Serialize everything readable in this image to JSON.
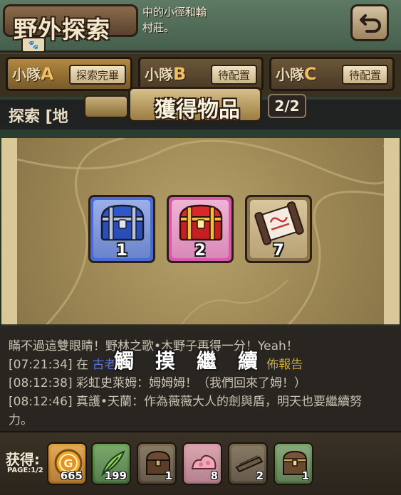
{
  "header": {
    "title": "野外探索",
    "description": "中的小徑和輪\n村莊。",
    "back_icon": "return-arrow-icon"
  },
  "squads": [
    {
      "label_prefix": "小隊",
      "letter": "A",
      "state": "探索完畢"
    },
    {
      "label_prefix": "小隊",
      "letter": "B",
      "state": "待配置"
    },
    {
      "label_prefix": "小隊",
      "letter": "C",
      "state": "待配置"
    }
  ],
  "location": {
    "text": "探索 [地"
  },
  "reward_popup": {
    "title": "獲得物品",
    "page": "2/2",
    "items": [
      {
        "icon": "blue-treasure-chest-icon",
        "count": "1",
        "frame_color": "#4a6ad8"
      },
      {
        "icon": "red-treasure-chest-icon",
        "count": "2",
        "frame_color": "#d85aa8"
      },
      {
        "icon": "scroll-icon",
        "count": "7",
        "frame_color": "#8a7448"
      }
    ]
  },
  "log": {
    "lines": [
      {
        "ts": "",
        "text": "瞞不過這雙眼睛！野林之歌•木野子再得一分！Yeah！"
      },
      {
        "ts": "[07:21:34]",
        "pre": "在",
        "hl": "古老",
        "mid": "",
        "hl2": "佈報告",
        "text": ""
      },
      {
        "ts": "[08:12:38]",
        "text": "彩虹史萊姆：姆姆姆！（我們回來了姆！）"
      },
      {
        "ts": "[08:12:46]",
        "text": "真護•天蘭：作為薇薇大人的劍與盾，明天也要繼續努"
      },
      {
        "ts": "",
        "text": "力。"
      }
    ],
    "continue_chars": [
      "觸",
      "摸",
      "繼",
      "續"
    ]
  },
  "gains": {
    "label": "获得:",
    "page": "PAGE:1/2",
    "items": [
      {
        "icon": "gold-coin-icon",
        "count": "665"
      },
      {
        "icon": "green-feather-icon",
        "count": "199"
      },
      {
        "icon": "wooden-chest-icon",
        "count": "1"
      },
      {
        "icon": "pink-ore-icon",
        "count": "8"
      },
      {
        "icon": "wooden-plank-icon",
        "count": "2"
      },
      {
        "icon": "treasure-chest-icon",
        "count": "1"
      }
    ]
  }
}
